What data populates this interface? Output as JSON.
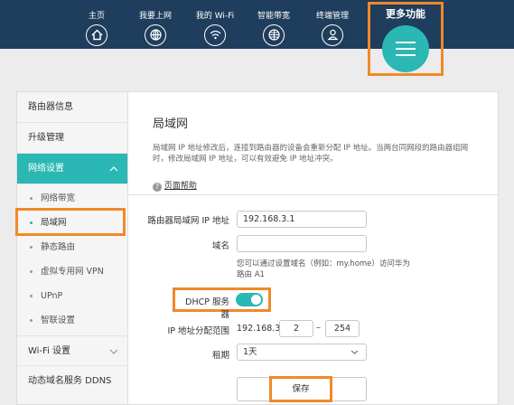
{
  "nav": {
    "home": "主页",
    "internet": "我要上网",
    "wifi": "我的 Wi-Fi",
    "bandwidth": "智能带宽",
    "terminal": "终端管理",
    "more": "更多功能"
  },
  "sidebar": {
    "router_info": "路由器信息",
    "upgrade": "升级管理",
    "network": "网络设置",
    "sub": [
      "网络带宽",
      "局域网",
      "静态路由",
      "虚拟专用网 VPN",
      "UPnP",
      "智联设置"
    ],
    "wifi": "Wi-Fi 设置",
    "ddns": "动态域名服务 DDNS"
  },
  "main": {
    "title": "局域网",
    "desc": "局域网 IP 地址修改后，连接到路由器的设备会重新分配 IP 地址。当两台同网段的路由器组网时，修改局域网 IP 地址，可以有效避免 IP 地址冲突。",
    "help": "页面帮助",
    "ip_label": "路由器局域网 IP 地址",
    "ip_value": "192.168.3.1",
    "domain_label": "域名",
    "domain_value": "",
    "domain_hint": "您可以通过设置域名（例如：my.home）访问华为路由 A1",
    "dhcp_label": "DHCP 服务器",
    "dhcp_on": true,
    "range_label": "IP 地址分配范围",
    "range_prefix": "192.168.3.",
    "range_start": "2",
    "range_dash": "–",
    "range_end": "254",
    "lease_label": "租期",
    "lease_value": "1天",
    "save": "保存"
  }
}
